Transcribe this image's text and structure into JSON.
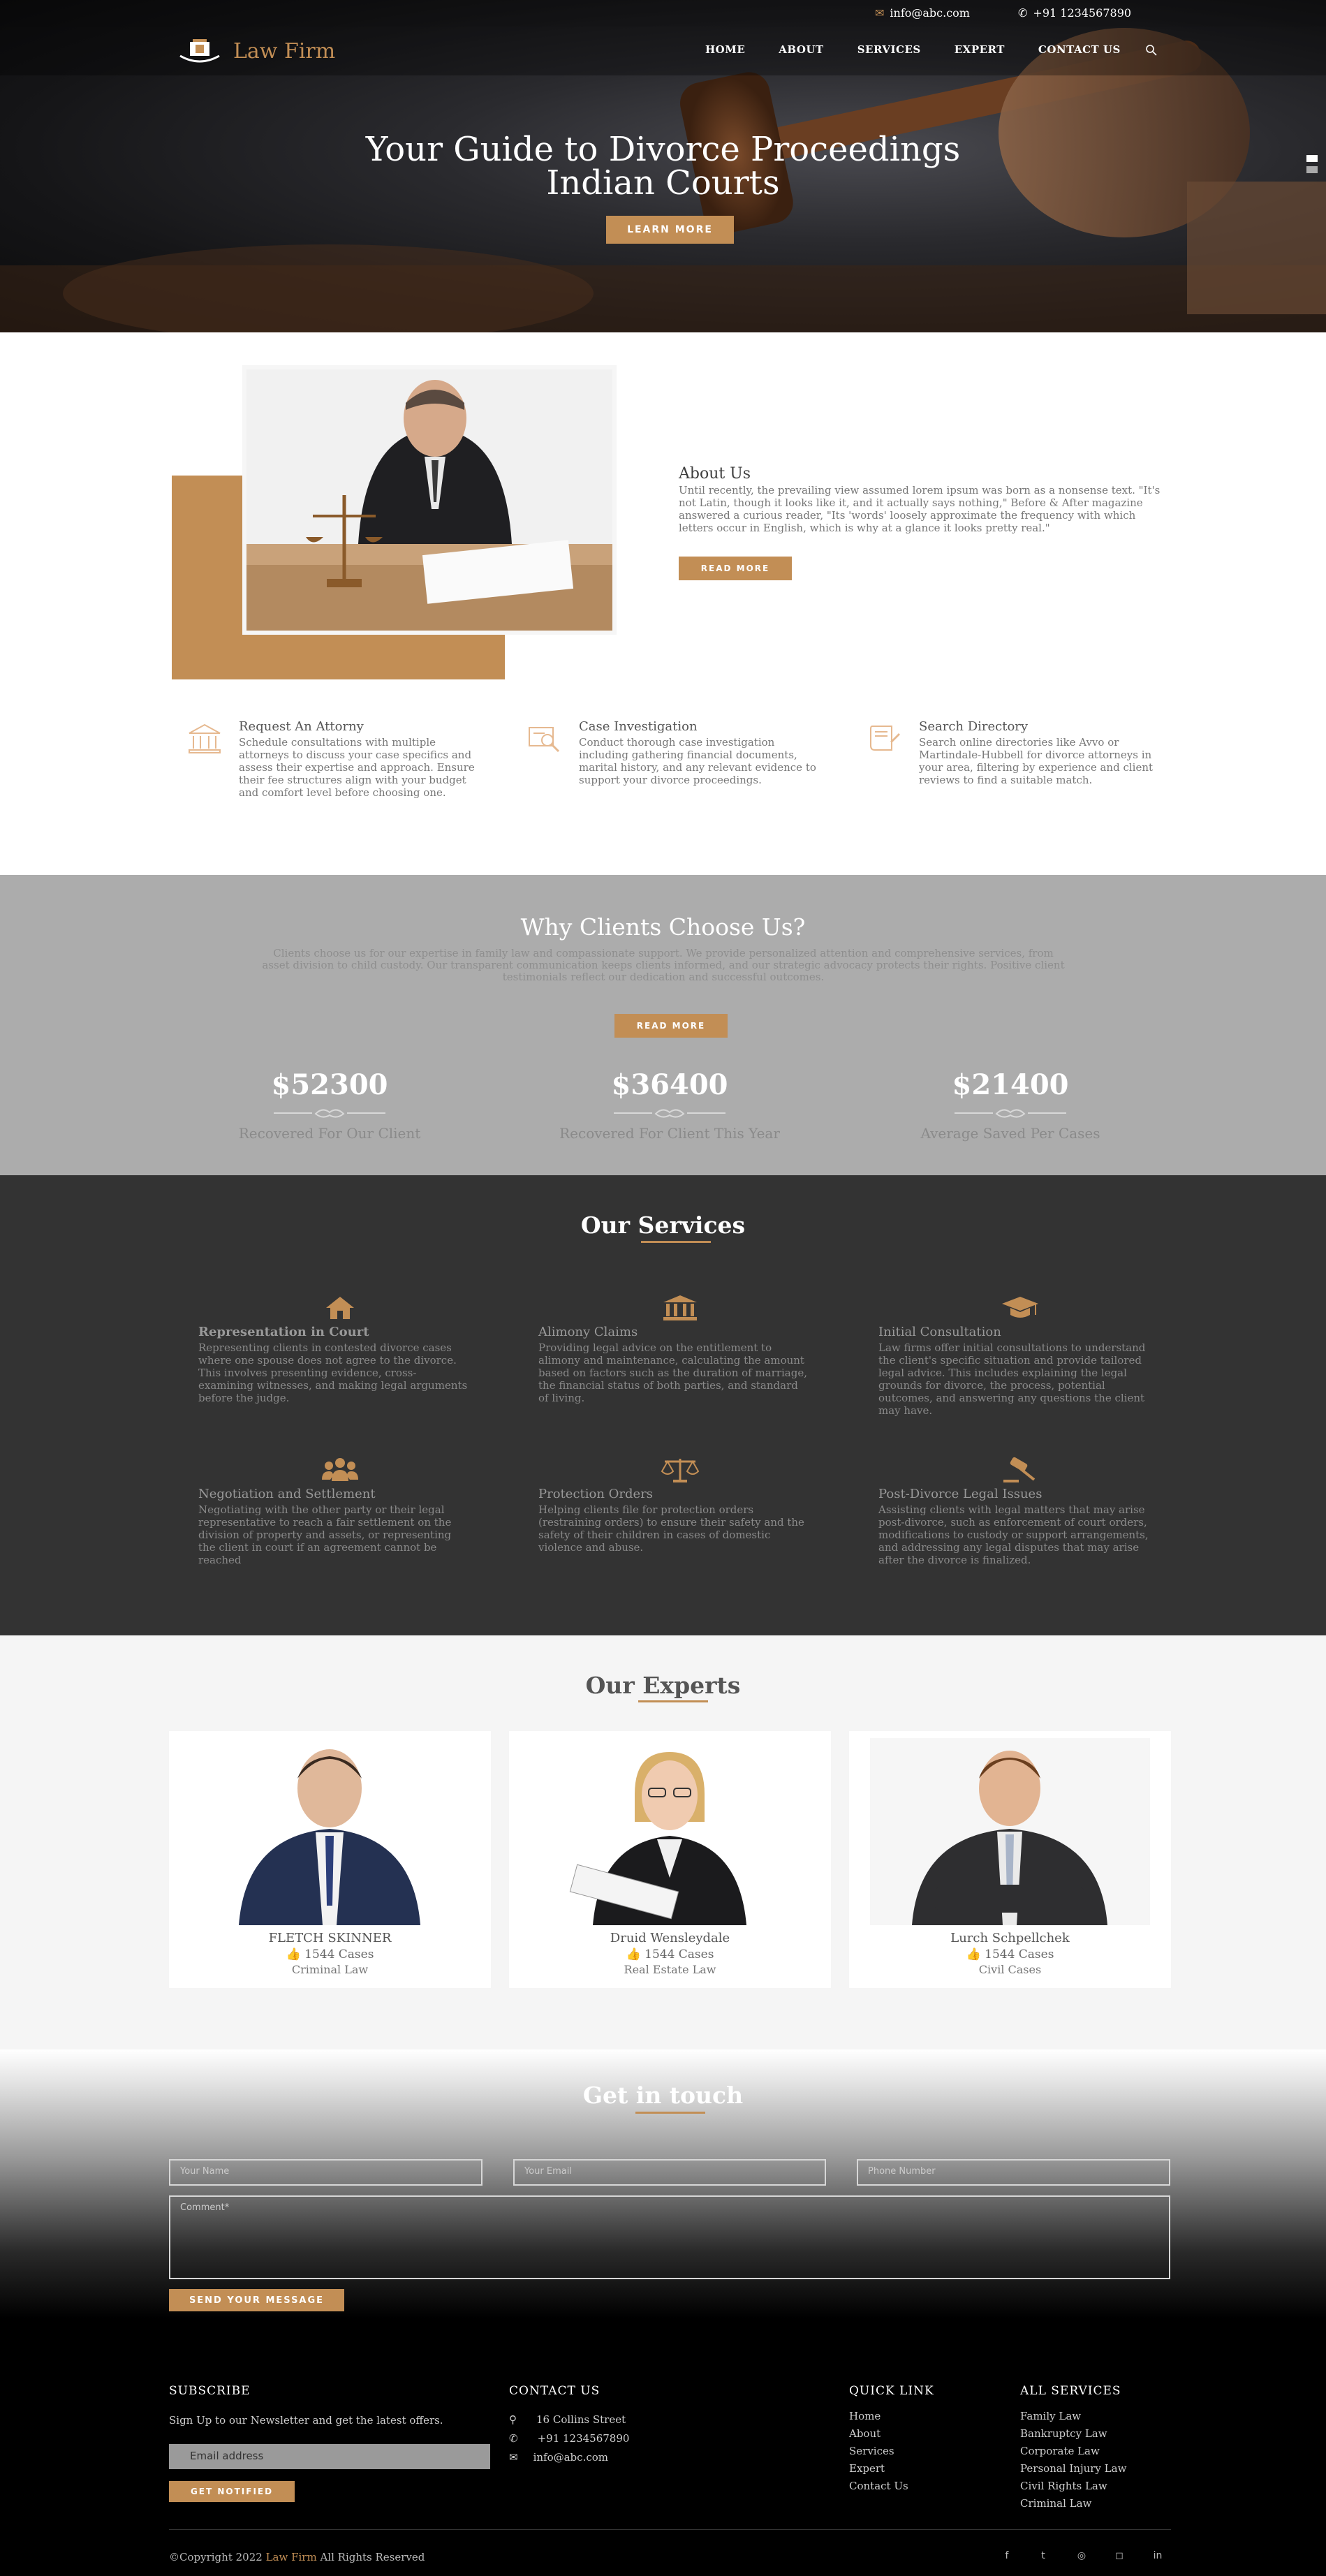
{
  "topbar": {
    "email": "info@abc.com",
    "phone": "+91 1234567890"
  },
  "brand": {
    "name": "Law Firm"
  },
  "nav": [
    "HOME",
    "ABOUT",
    "SERVICES",
    "EXPERT",
    "CONTACT US"
  ],
  "hero": {
    "title_line1": "Your Guide to Divorce Proceedings",
    "title_line2": "Indian Courts",
    "button": "LEARN MORE"
  },
  "about": {
    "title": "About Us",
    "text": "Until recently, the prevailing view assumed lorem ipsum was born as a nonsense text. \"It's not Latin, though it looks like it, and it actually says nothing,\" Before & After magazine answered a curious reader, \"Its 'words' loosely approximate the frequency with which letters occur in English, which is why at a glance it looks pretty real.\"",
    "button": "READ MORE"
  },
  "features": [
    {
      "title": "Request An Attorny",
      "text": "Schedule consultations with multiple attorneys to discuss your case specifics and assess their expertise and approach. Ensure their fee structures align with your budget and comfort level before choosing one."
    },
    {
      "title": "Case Investigation",
      "text": "Conduct thorough case investigation including gathering financial documents, marital history, and any relevant evidence to support your divorce proceedings."
    },
    {
      "title": "Search Directory",
      "text": "Search online directories like Avvo or Martindale-Hubbell for divorce attorneys in your area, filtering by experience and client reviews to find a suitable match."
    }
  ],
  "why": {
    "title": "Why Clients Choose Us?",
    "text": "Clients choose us for our expertise in family law and compassionate support. We provide personalized attention and comprehensive services, from asset division to child custody. Our transparent communication keeps clients informed, and our strategic advocacy protects their rights. Positive client testimonials reflect our dedication and successful outcomes.",
    "button": "READ MORE",
    "stats": [
      {
        "value": "$52300",
        "label": "Recovered For Our Client"
      },
      {
        "value": "$36400",
        "label": "Recovered For Client This Year"
      },
      {
        "value": "$21400",
        "label": "Average Saved Per Cases"
      }
    ]
  },
  "services": {
    "title_part1": "Our ",
    "title_part2": "Services",
    "items": [
      {
        "icon": "home-icon",
        "title": "Representation in Court",
        "text": "Representing clients in contested divorce cases where one spouse does not agree to the divorce. This involves presenting evidence, cross-examining witnesses, and making legal arguments before the judge."
      },
      {
        "icon": "courthouse-icon",
        "title": "Alimony Claims",
        "text": "Providing legal advice on the entitlement to alimony and maintenance, calculating the amount based on factors such as the duration of marriage, the financial status of both parties, and standard of living."
      },
      {
        "icon": "graduation-cap-icon",
        "title": "Initial Consultation",
        "text": "Law firms offer initial consultations to understand the client's specific situation and provide tailored legal advice. This includes explaining the legal grounds for divorce, the process, potential outcomes, and answering any questions the client may have."
      },
      {
        "icon": "users-icon",
        "title": "Negotiation and Settlement",
        "text": "Negotiating with the other party or their legal representative to reach a fair settlement on the division of property and assets, or representing the client in court if an agreement cannot be reached"
      },
      {
        "icon": "scales-icon",
        "title": "Protection Orders",
        "text": "Helping clients file for protection orders (restraining orders) to ensure their safety and the safety of their children in cases of domestic violence and abuse."
      },
      {
        "icon": "gavel-icon",
        "title": "Post-Divorce Legal Issues",
        "text": "Assisting clients with legal matters that may arise post-divorce, such as enforcement of court orders, modifications to custody or support arrangements, and addressing any legal disputes that may arise after the divorce is finalized."
      }
    ]
  },
  "experts": {
    "title_part1": "Our ",
    "title_part2": "Experts",
    "items": [
      {
        "name": "FLETCH SKINNER",
        "cases": "1544 Cases",
        "field": "Criminal Law"
      },
      {
        "name": "Druid Wensleydale",
        "cases": "1544 Cases",
        "field": "Real Estate Law"
      },
      {
        "name": "Lurch Schpellchek",
        "cases": "1544 Cases",
        "field": "Civil Cases"
      }
    ]
  },
  "contact": {
    "title_part1": "Get ",
    "title_part2": "in touch",
    "name_placeholder": "Your Name",
    "email_placeholder": "Your Email",
    "phone_placeholder": "Phone Number",
    "comment_placeholder": "Comment*",
    "button": "SEND YOUR MESSAGE"
  },
  "footer": {
    "subscribe_title": "SUBSCRIBE",
    "subscribe_text": "Sign Up to our Newsletter and get the latest offers.",
    "email_placeholder": "Email address",
    "notify_button": "GET NOTIFIED",
    "contact_title": "CONTACT US",
    "address": "16 Collins Street",
    "phone": "+91 1234567890",
    "email": "info@abc.com",
    "quick_title": "QUICK LINK",
    "quick_links": [
      "Home",
      "About",
      "Services",
      "Expert",
      "Contact Us"
    ],
    "services_title": "ALL SERVICES",
    "service_links": [
      "Family Law",
      "Bankruptcy Law",
      "Corporate Law",
      "Personal Injury Law",
      "Civil Rights Law",
      "Criminal Law"
    ],
    "copyright_pre": "©Copyright 2022 ",
    "copyright_brand": "Law Firm",
    "copyright_post": " All Rights Reserved",
    "social": [
      "facebook-icon",
      "twitter-icon",
      "dribbble-icon",
      "instagram-icon",
      "linkedin-icon"
    ]
  },
  "colors": {
    "accent": "#c28e55",
    "dark": "#333333",
    "gray": "#acacac"
  }
}
